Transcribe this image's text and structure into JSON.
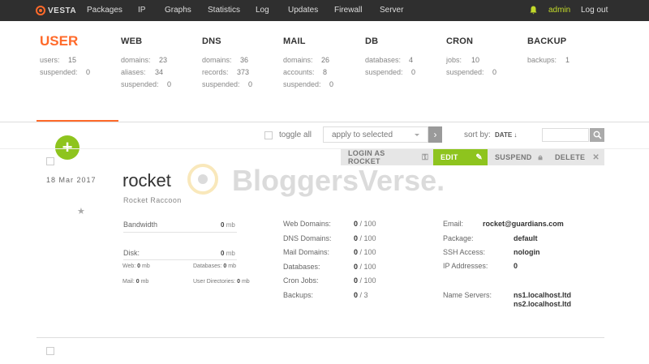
{
  "nav": {
    "logo": "VESTA",
    "items": [
      "Packages",
      "IP",
      "Graphs",
      "Statistics",
      "Log",
      "Updates",
      "Firewall",
      "Server"
    ],
    "user": "admin",
    "logout": "Log out"
  },
  "stats": {
    "user": {
      "title": "USER",
      "rows": [
        {
          "label": "users:",
          "value": "15"
        },
        {
          "label": "suspended:",
          "value": "0"
        }
      ]
    },
    "web": {
      "title": "WEB",
      "rows": [
        {
          "label": "domains:",
          "value": "23"
        },
        {
          "label": "aliases:",
          "value": "34"
        },
        {
          "label": "suspended:",
          "value": "0"
        }
      ]
    },
    "dns": {
      "title": "DNS",
      "rows": [
        {
          "label": "domains:",
          "value": "36"
        },
        {
          "label": "records:",
          "value": "373"
        },
        {
          "label": "suspended:",
          "value": "0"
        }
      ]
    },
    "mail": {
      "title": "MAIL",
      "rows": [
        {
          "label": "domains:",
          "value": "26"
        },
        {
          "label": "accounts:",
          "value": "8"
        },
        {
          "label": "suspended:",
          "value": "0"
        }
      ]
    },
    "db": {
      "title": "DB",
      "rows": [
        {
          "label": "databases:",
          "value": "4"
        },
        {
          "label": "suspended:",
          "value": "0"
        }
      ]
    },
    "cron": {
      "title": "CRON",
      "rows": [
        {
          "label": "jobs:",
          "value": "10"
        },
        {
          "label": "suspended:",
          "value": "0"
        }
      ]
    },
    "backup": {
      "title": "BACKUP",
      "rows": [
        {
          "label": "backups:",
          "value": "1"
        }
      ]
    }
  },
  "toolbar": {
    "toggle_all": "toggle all",
    "apply_placeholder": "apply to selected",
    "sort_by": "sort by:",
    "sort_value": "DATE ↓"
  },
  "actions": {
    "login_as": "LOGIN AS ROCKET",
    "edit": "EDIT",
    "suspend": "SUSPEND",
    "delete": "DELETE"
  },
  "user_record": {
    "date": "18 Mar 2017",
    "name": "rocket",
    "full_name": "Rocket Raccoon",
    "bandwidth": {
      "label": "Bandwidth",
      "value": "0",
      "unit": "mb"
    },
    "disk": {
      "label": "Disk:",
      "value": "0",
      "unit": "mb"
    },
    "disk_breakdown": [
      {
        "label": "Web:",
        "value": "0",
        "unit": "mb"
      },
      {
        "label": "Databases:",
        "value": "0",
        "unit": "mb"
      },
      {
        "label": "Mail:",
        "value": "0",
        "unit": "mb"
      },
      {
        "label": "User Directories:",
        "value": "0",
        "unit": "mb"
      }
    ],
    "resources": [
      {
        "label": "Web Domains:",
        "used": "0",
        "limit": "/ 100"
      },
      {
        "label": "DNS Domains:",
        "used": "0",
        "limit": "/ 100"
      },
      {
        "label": "Mail Domains:",
        "used": "0",
        "limit": "/ 100"
      },
      {
        "label": "Databases:",
        "used": "0",
        "limit": "/ 100"
      },
      {
        "label": "Cron Jobs:",
        "used": "0",
        "limit": "/ 100"
      },
      {
        "label": "Backups:",
        "used": "0",
        "limit": "/ 3"
      }
    ],
    "info": [
      {
        "label": "Email:",
        "value": "rocket@guardians.com"
      },
      {
        "label": "Package:",
        "value": "default"
      },
      {
        "label": "SSH Access:",
        "value": "nologin"
      },
      {
        "label": "IP Addresses:",
        "value": "0"
      }
    ],
    "name_servers": {
      "label": "Name Servers:",
      "values": [
        "ns1.localhost.ltd",
        "ns2.localhost.ltd"
      ]
    }
  },
  "watermark": "BloggersVerse.",
  "colors": {
    "accent": "#ff6a2a",
    "green": "#8ec41e",
    "topbar": "#2f2f2f"
  }
}
